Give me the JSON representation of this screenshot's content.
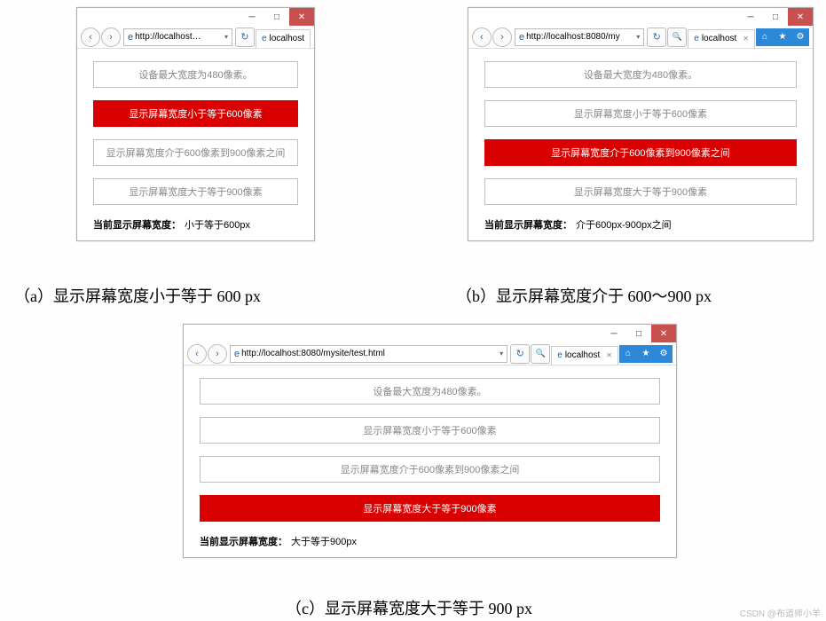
{
  "watermark": "CSDN @布道师小羊",
  "panels": [
    {
      "url": "http://localhost…",
      "tab": "localhost",
      "boxes": [
        {
          "text": "设备最大宽度为480像素。",
          "active": false
        },
        {
          "text": "显示屏幕宽度小于等于600像素",
          "active": true
        },
        {
          "text": "显示屏幕宽度介于600像素到900像素之间",
          "active": false
        },
        {
          "text": "显示屏幕宽度大于等于900像素",
          "active": false
        }
      ],
      "status_label": "当前显示屏幕宽度：",
      "status_value": "小于等于600px",
      "caption": "（a）显示屏幕宽度小于等于 600 px"
    },
    {
      "url": "http://localhost:8080/my",
      "tab": "localhost",
      "boxes": [
        {
          "text": "设备最大宽度为480像素。",
          "active": false
        },
        {
          "text": "显示屏幕宽度小于等于600像素",
          "active": false
        },
        {
          "text": "显示屏幕宽度介于600像素到900像素之间",
          "active": true
        },
        {
          "text": "显示屏幕宽度大于等于900像素",
          "active": false
        }
      ],
      "status_label": "当前显示屏幕宽度：",
      "status_value": "介于600px-900px之间",
      "caption": "（b）显示屏幕宽度介于 600～900 px"
    },
    {
      "url": "http://localhost:8080/mysite/test.html",
      "tab": "localhost",
      "boxes": [
        {
          "text": "设备最大宽度为480像素。",
          "active": false
        },
        {
          "text": "显示屏幕宽度小于等于600像素",
          "active": false
        },
        {
          "text": "显示屏幕宽度介于600像素到900像素之间",
          "active": false
        },
        {
          "text": "显示屏幕宽度大于等于900像素",
          "active": true
        }
      ],
      "status_label": "当前显示屏幕宽度：",
      "status_value": "大于等于900px",
      "caption": "（c）显示屏幕宽度大于等于 900 px"
    }
  ]
}
